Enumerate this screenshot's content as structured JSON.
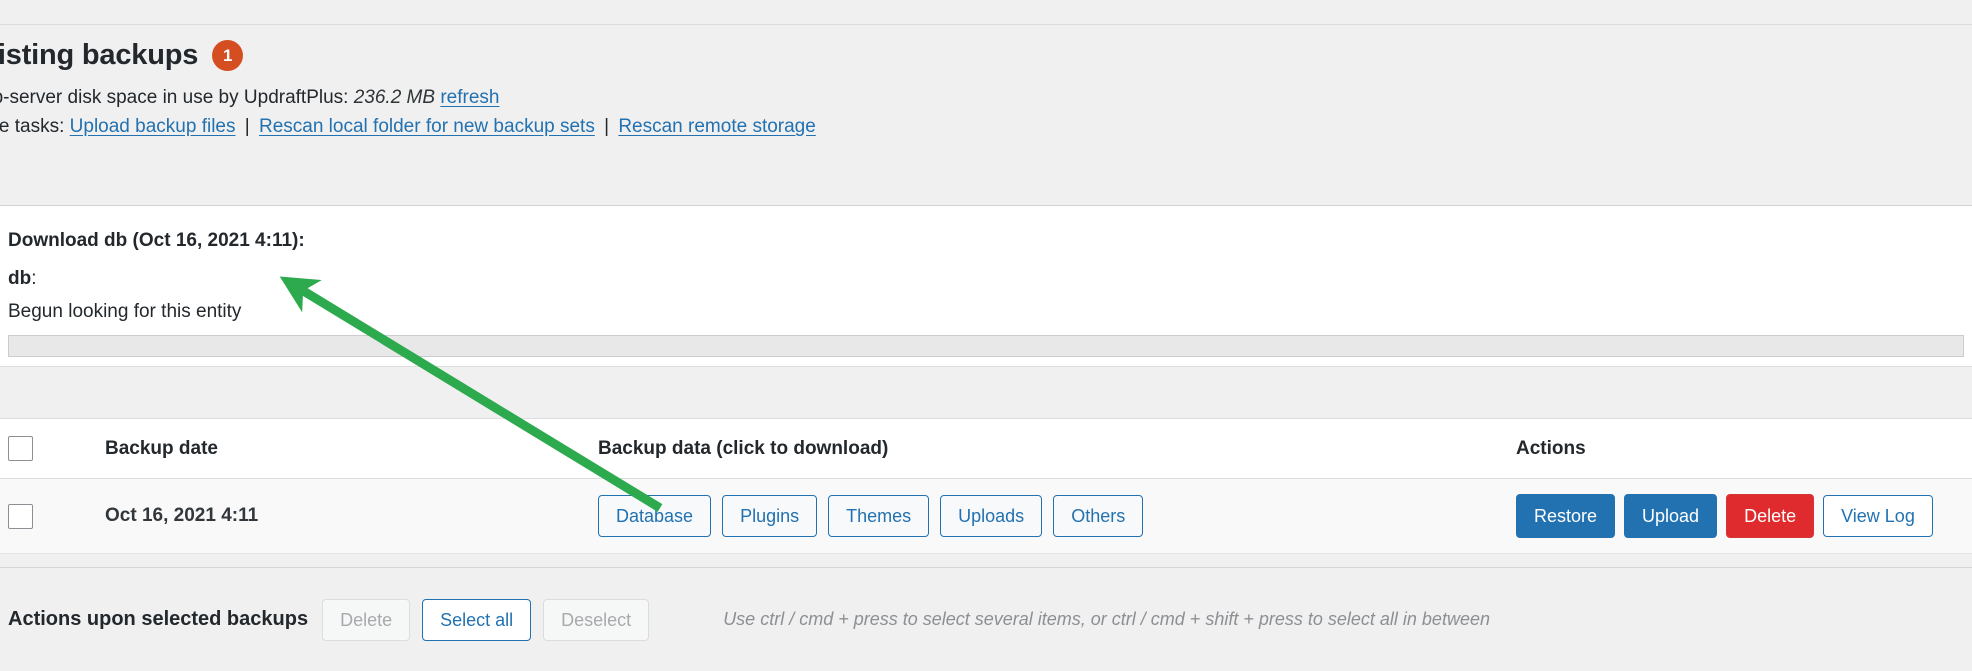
{
  "header": {
    "title": "xisting backups",
    "badge_count": "1",
    "disk_prefix": "eb-server disk space in use by UpdraftPlus:",
    "disk_size": "236.2 MB",
    "refresh_label": "refresh",
    "more_tasks_label": "ore tasks:",
    "separator": "|",
    "tasks": [
      {
        "label": "Upload backup files"
      },
      {
        "label": "Rescan local folder for new backup sets"
      },
      {
        "label": "Rescan remote storage"
      }
    ]
  },
  "download": {
    "title": "Download db (Oct 16, 2021 4:11):",
    "entity_name": "db",
    "entity_suffix": ":",
    "status": "Begun looking for this entity",
    "progress_percent": 0
  },
  "table": {
    "columns": {
      "backup_date": "Backup date",
      "backup_data": "Backup data (click to download)",
      "actions": "Actions"
    },
    "rows": [
      {
        "date": "Oct 16, 2021 4:11",
        "data_buttons": [
          "Database",
          "Plugins",
          "Themes",
          "Uploads",
          "Others"
        ],
        "action_buttons": [
          {
            "label": "Restore",
            "style": "primary"
          },
          {
            "label": "Upload",
            "style": "primary"
          },
          {
            "label": "Delete",
            "style": "danger"
          },
          {
            "label": "View Log",
            "style": "white"
          }
        ]
      }
    ]
  },
  "footer": {
    "label": "Actions upon selected backups",
    "delete_label": "Delete",
    "select_all_label": "Select all",
    "deselect_label": "Deselect",
    "hint": "Use ctrl / cmd + press to select several items, or ctrl / cmd + shift + press to select all in between"
  },
  "colors": {
    "badge": "#d54e21",
    "link": "#2271b1",
    "primary": "#2271b1",
    "danger": "#e02b2e",
    "annotation_arrow": "#2eaa4e"
  }
}
